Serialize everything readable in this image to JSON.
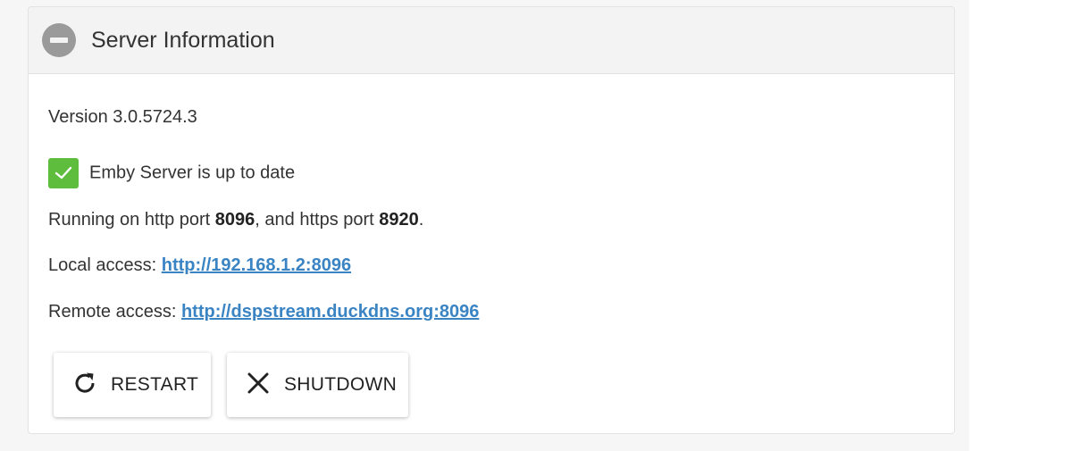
{
  "panel": {
    "title": "Server Information"
  },
  "version_text": "Version 3.0.5724.3",
  "update_status": "Emby Server is up to date",
  "ports": {
    "prefix": "Running on http port ",
    "http_port": "8096",
    "middle": ", and https port ",
    "https_port": "8920",
    "suffix": "."
  },
  "local_access": {
    "label": "Local access: ",
    "url": "http://192.168.1.2:8096"
  },
  "remote_access": {
    "label": "Remote access: ",
    "url": "http://dspstream.duckdns.org:8096"
  },
  "buttons": {
    "restart_label": "RESTART",
    "shutdown_label": "SHUTDOWN"
  },
  "icons": {
    "collapse": "minus-circle-icon",
    "status": "check-icon",
    "restart": "refresh-icon",
    "shutdown": "close-icon"
  },
  "colors": {
    "link": "#3a84c4",
    "success": "#5fbd3e",
    "collapse_icon": "#9a9a9a"
  }
}
